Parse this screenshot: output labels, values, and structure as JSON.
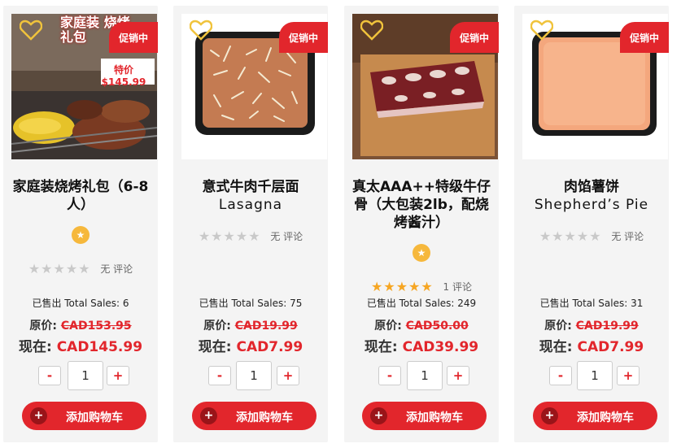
{
  "sale_label": "促销中",
  "cart_label": "添加购物车",
  "products": [
    {
      "title_cn": "家庭装烧烤礼包（6-8人）",
      "title_en": "",
      "img_overlay_text": "家庭装 烧烤礼包",
      "img_price_tag": "特价 $145.99",
      "rating": 0,
      "review_text": "无 评论",
      "sold_text": "已售出 Total Sales: 6",
      "orig_label": "原价:",
      "orig_price": "CAD153.95",
      "now_label": "现在:",
      "now_price": "CAD145.99",
      "qty": "1"
    },
    {
      "title_cn": "意式牛肉千层面",
      "title_en": "Lasagna",
      "rating": 0,
      "review_text": "无 评论",
      "sold_text": "已售出 Total Sales: 75",
      "orig_label": "原价:",
      "orig_price": "CAD19.99",
      "now_label": "现在:",
      "now_price": "CAD7.99",
      "qty": "1"
    },
    {
      "title_cn": "真太AAA++特级牛仔骨（大包装2lb，配烧烤酱汁）",
      "title_en": "",
      "rating": 5,
      "review_text": "1 评论",
      "sold_text": "已售出 Total Sales: 249",
      "orig_label": "原价:",
      "orig_price": "CAD50.00",
      "now_label": "现在:",
      "now_price": "CAD39.99",
      "qty": "1"
    },
    {
      "title_cn": "肉馅薯饼",
      "title_en": "Shepherd’s Pie",
      "rating": 0,
      "review_text": "无 评论",
      "sold_text": "已售出 Total Sales: 31",
      "orig_label": "原价:",
      "orig_price": "CAD19.99",
      "now_label": "现在:",
      "now_price": "CAD7.99",
      "qty": "1"
    }
  ],
  "qty_minus": "-",
  "qty_plus": "+",
  "colors": {
    "accent": "#e2262c",
    "card_bg": "#f4f4f4",
    "star": "#f6a623"
  }
}
